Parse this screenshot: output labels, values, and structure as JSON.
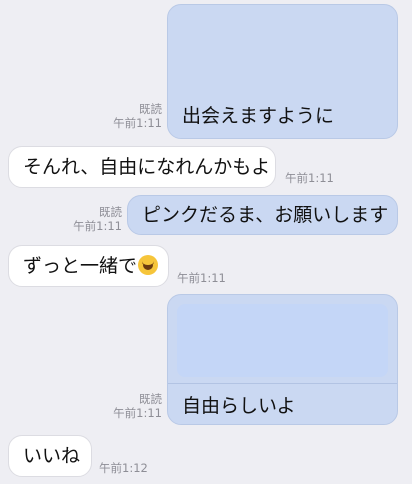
{
  "messages": [
    {
      "side": "sent",
      "text": "出会えますように",
      "read": "既読",
      "time": "午前1:11"
    },
    {
      "side": "received",
      "text": "そんれ、自由になれんかもよ",
      "time": "午前1:11"
    },
    {
      "side": "sent",
      "text": "ピンクだるま、お願いします",
      "read": "既読",
      "time": "午前1:11"
    },
    {
      "side": "received",
      "text": "ずっと一緒で",
      "emoji": "rolling-laughing-emoji",
      "time": "午前1:11"
    },
    {
      "side": "sent",
      "text": "自由らしいよ",
      "read": "既読",
      "time": "午前1:11"
    },
    {
      "side": "received",
      "text": "いいね",
      "time": "午前1:12"
    }
  ]
}
